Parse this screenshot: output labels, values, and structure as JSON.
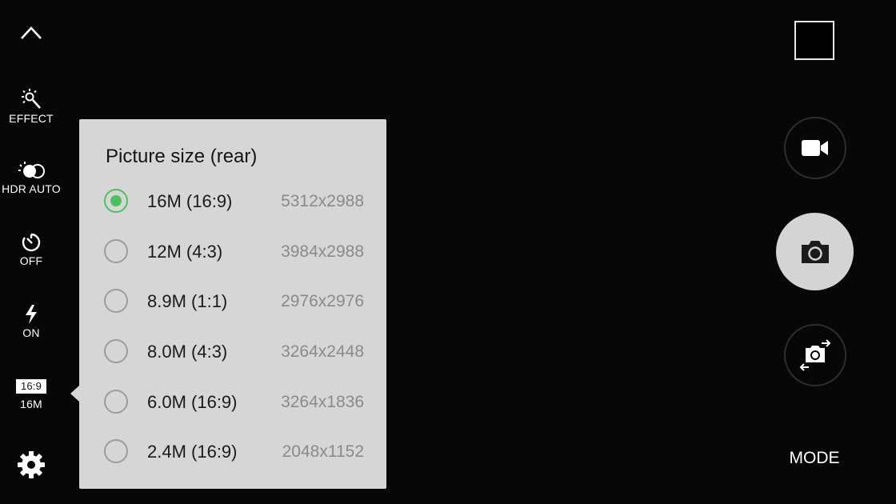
{
  "left_toolbar": {
    "effect_label": "EFFECT",
    "hdr_label": "HDR AUTO",
    "timer_label": "OFF",
    "flash_label": "ON",
    "ratio_badge": "16:9",
    "size_label": "16M"
  },
  "popup": {
    "title": "Picture size (rear)",
    "options": [
      {
        "label": "16M (16:9)",
        "resolution": "5312x2988",
        "selected": true
      },
      {
        "label": "12M (4:3)",
        "resolution": "3984x2988",
        "selected": false
      },
      {
        "label": "8.9M (1:1)",
        "resolution": "2976x2976",
        "selected": false
      },
      {
        "label": "8.0M (4:3)",
        "resolution": "3264x2448",
        "selected": false
      },
      {
        "label": "6.0M (16:9)",
        "resolution": "3264x1836",
        "selected": false
      },
      {
        "label": "2.4M (16:9)",
        "resolution": "2048x1152",
        "selected": false
      }
    ]
  },
  "right_controls": {
    "mode_label": "MODE"
  },
  "colors": {
    "accent": "#4cc25e",
    "popup_bg": "#d6d6d6",
    "background": "#070707"
  },
  "icons": [
    "chevron-up-icon",
    "effect-wand-icon",
    "hdr-icon",
    "timer-icon",
    "flash-icon",
    "settings-gear-icon",
    "video-camera-icon",
    "camera-icon",
    "switch-camera-icon"
  ]
}
